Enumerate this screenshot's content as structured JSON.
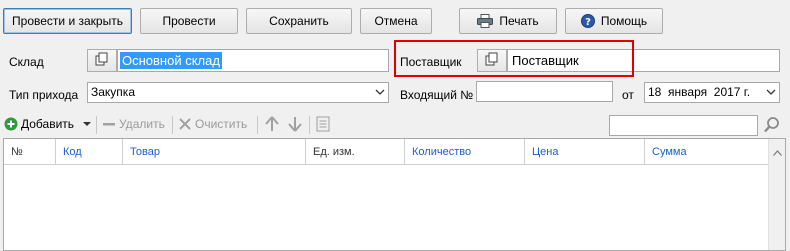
{
  "toolbar": {
    "post_close_label": "Провести и закрыть",
    "post_label": "Провести",
    "save_label": "Сохранить",
    "cancel_label": "Отмена",
    "print_label": "Печать",
    "help_label": "Помощь"
  },
  "form": {
    "warehouse_label": "Склад",
    "warehouse_value": "Основной склад",
    "supplier_label": "Поставщик",
    "supplier_value": "Поставщик",
    "receipt_type_label": "Тип прихода",
    "receipt_type_value": "Закупка",
    "incoming_no_label": "Входящий №",
    "incoming_no_value": "",
    "from_label": "от",
    "date_day": "18",
    "date_month": "января",
    "date_year": "2017 г."
  },
  "table_toolbar": {
    "add_label": "Добавить",
    "delete_label": "Удалить",
    "clear_label": "Очистить",
    "search_value": ""
  },
  "table": {
    "columns": [
      "№",
      "Код",
      "Товар",
      "Ед. изм.",
      "Количество",
      "Цена",
      "Сумма"
    ],
    "rows": []
  },
  "colors": {
    "accent_blue": "#1a5fcf",
    "selection": "#3399ff",
    "highlight_red": "#e00000",
    "add_green": "#2e9a3a"
  }
}
